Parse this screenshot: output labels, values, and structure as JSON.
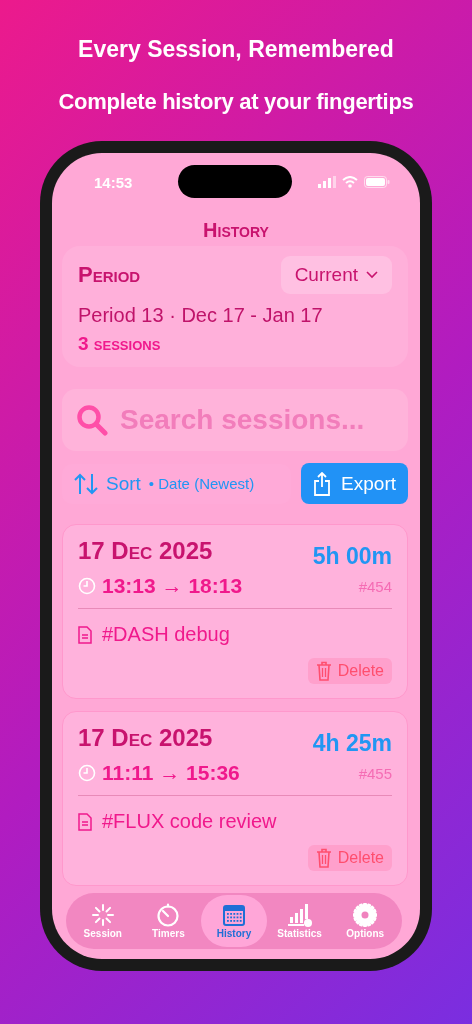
{
  "headline": "Every Session, Remembered",
  "subheadline": "Complete history at your fingertips",
  "status_bar": {
    "time": "14:53"
  },
  "title": "History",
  "period": {
    "label": "Period",
    "picker": "Current",
    "range": "Period 13 · Dec 17 - Jan 17",
    "count": "3 sessions"
  },
  "search": {
    "placeholder": "Search sessions..."
  },
  "sort": {
    "label": "Sort",
    "value": "• Date (Newest)"
  },
  "export": "Export",
  "sessions": [
    {
      "date": "17 Dec 2025",
      "duration": "5h 00m",
      "times": "13:13 → 18:13",
      "number": "#454",
      "note": "#DASH debug",
      "delete": "Delete"
    },
    {
      "date": "17 Dec 2025",
      "duration": "4h 25m",
      "times": "11:11 → 15:36",
      "number": "#455",
      "note": "#FLUX code review",
      "delete": "Delete"
    }
  ],
  "tabs": [
    {
      "label": "Session",
      "kind": "spinner",
      "selected": false
    },
    {
      "label": "Timers",
      "kind": "timer",
      "selected": false
    },
    {
      "label": "History",
      "kind": "calendar",
      "selected": true
    },
    {
      "label": "Statistics",
      "kind": "chart",
      "selected": false
    },
    {
      "label": "Options",
      "kind": "gear",
      "selected": false
    }
  ]
}
